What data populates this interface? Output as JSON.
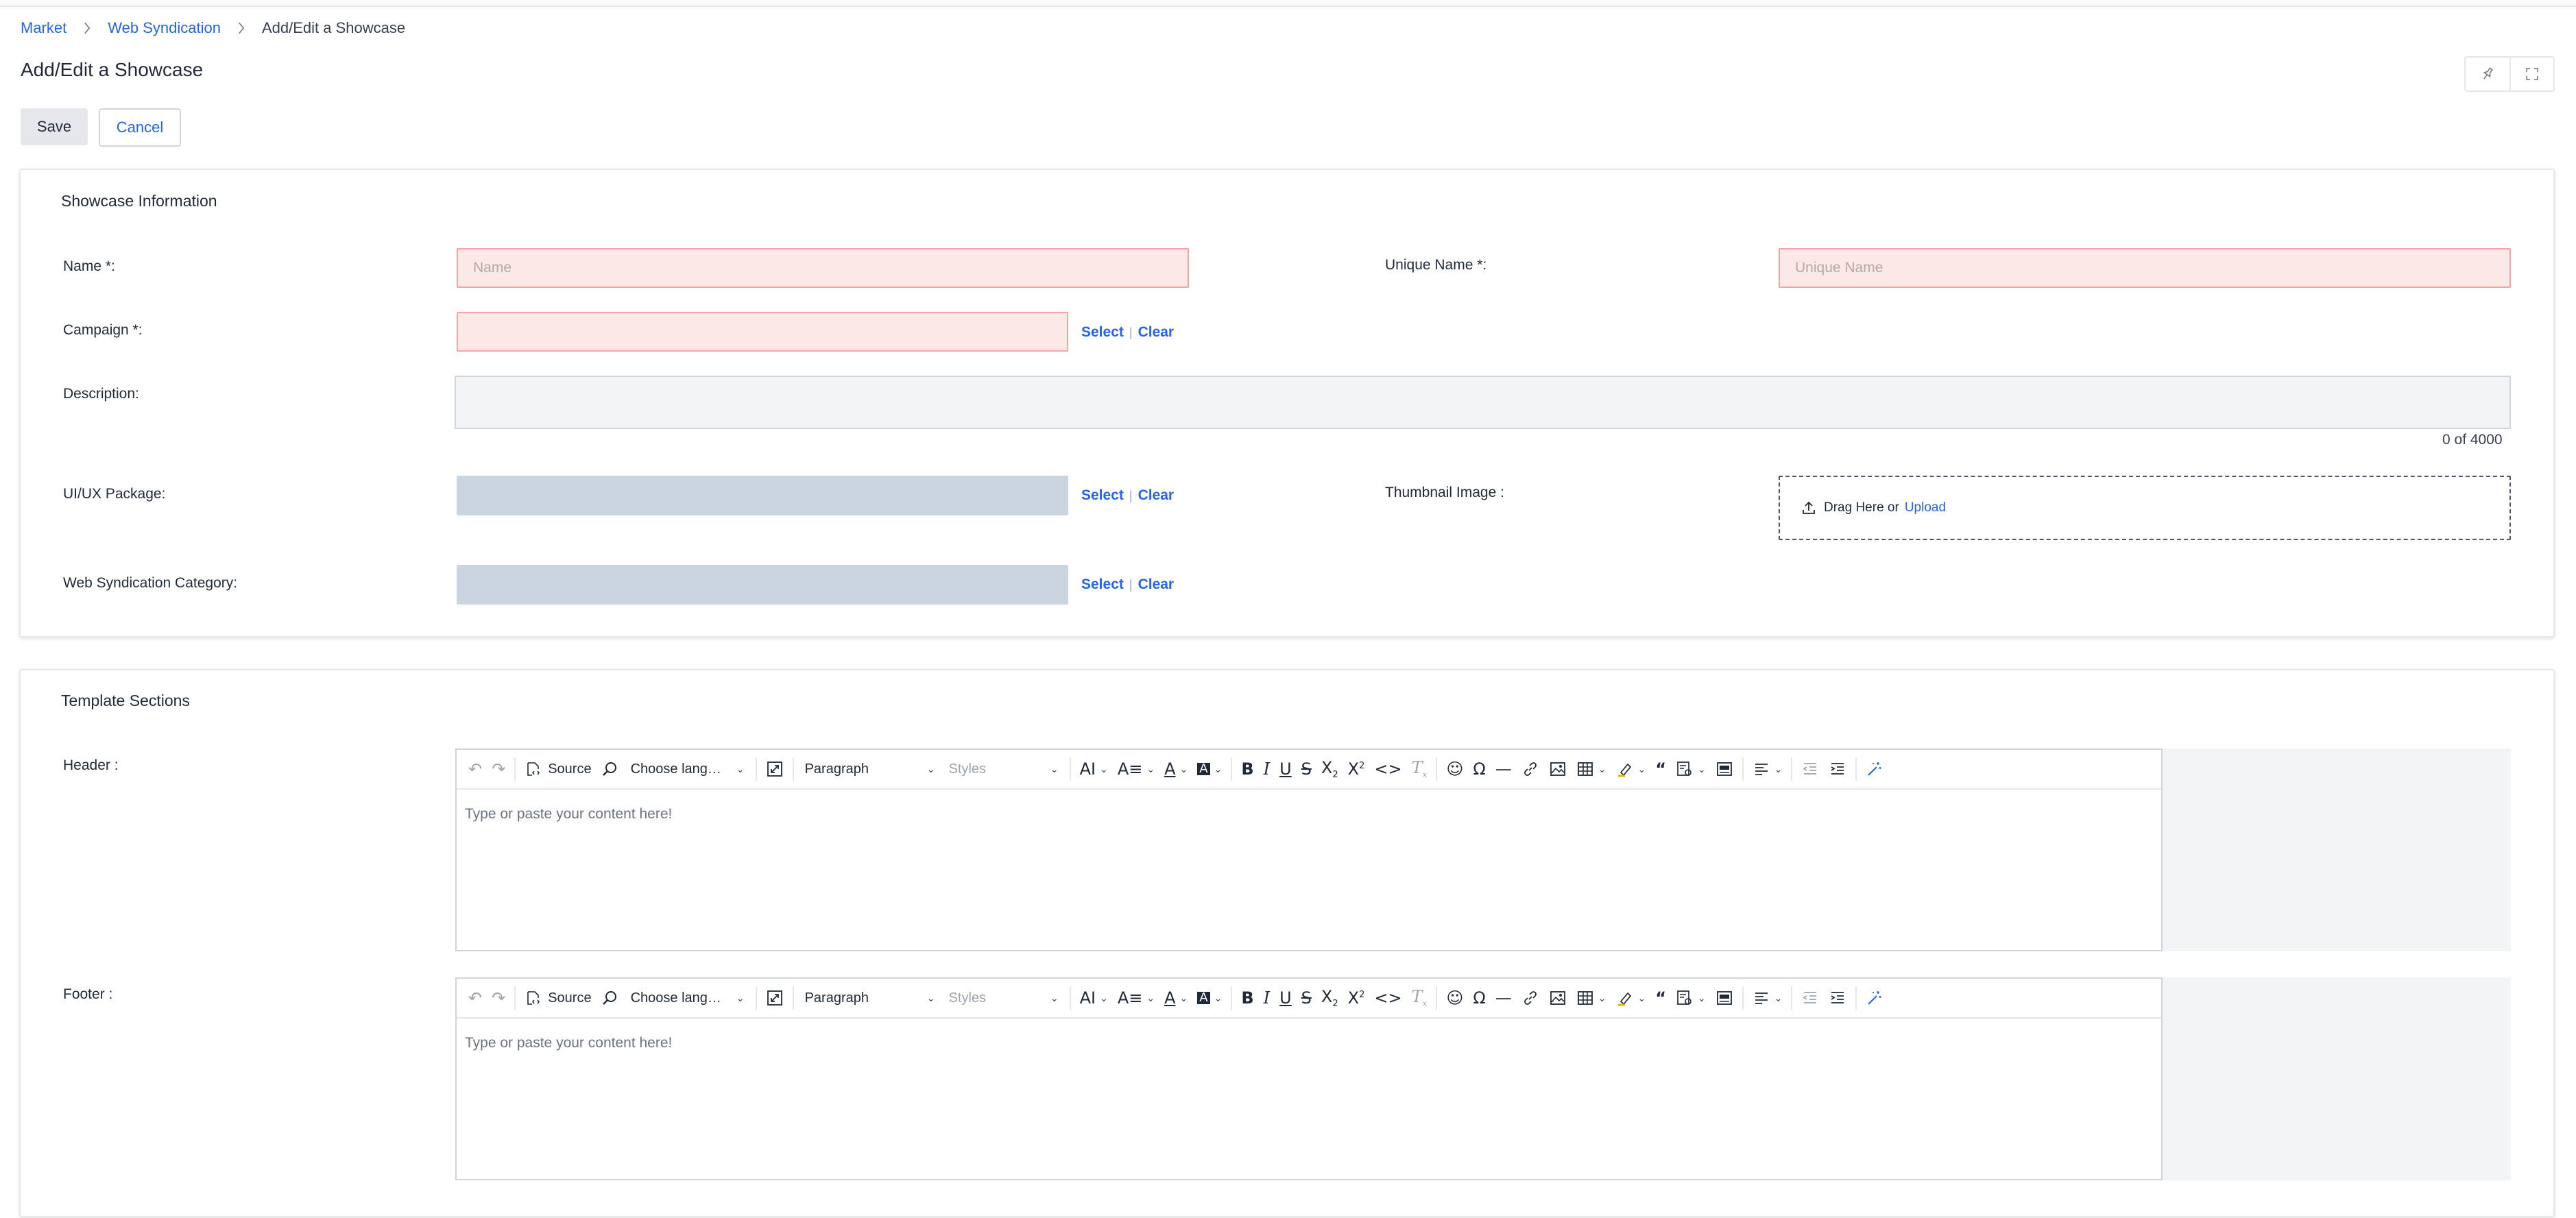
{
  "breadcrumb": {
    "market": "Market",
    "web_syndication": "Web Syndication",
    "current": "Add/Edit a Showcase"
  },
  "page": {
    "title": "Add/Edit a Showcase"
  },
  "actions": {
    "save": "Save",
    "cancel": "Cancel"
  },
  "showcase_info": {
    "title": "Showcase Information",
    "name_label": "Name *:",
    "name_placeholder": "Name",
    "unique_name_label": "Unique Name *:",
    "unique_name_placeholder": "Unique Name",
    "campaign_label": "Campaign *:",
    "description_label": "Description:",
    "description_counter": "0 of 4000",
    "uiux_label": "UI/UX Package:",
    "thumbnail_label": "Thumbnail Image :",
    "category_label": "Web Syndication Category:",
    "select": "Select",
    "clear": "Clear",
    "drag_here": "Drag Here or",
    "upload": "Upload"
  },
  "template_sections": {
    "title": "Template Sections",
    "header_label": "Header :",
    "footer_label": "Footer :",
    "placeholder": "Type or paste your content here!"
  },
  "toolbar": {
    "source": "Source",
    "language": "Choose lang…",
    "paragraph": "Paragraph",
    "styles": "Styles"
  },
  "colors": {
    "link": "#2563eb",
    "required_bg": "#fde8e8",
    "required_border": "#f3a5a5",
    "locked_bg": "#cbd5e1"
  }
}
